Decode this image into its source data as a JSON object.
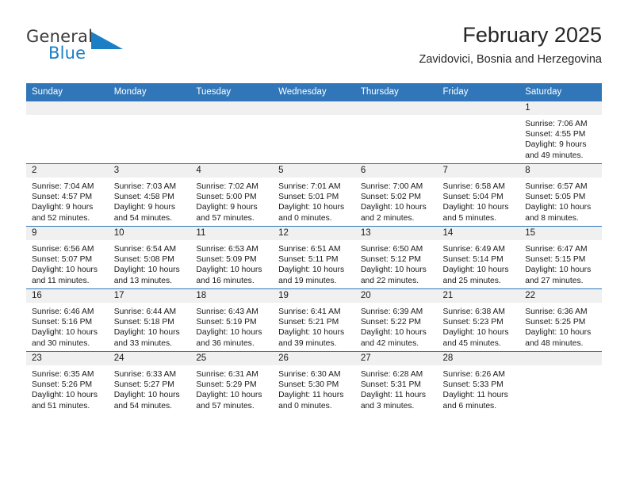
{
  "brand": {
    "name_general": "General",
    "name_blue": "Blue",
    "logo_icon": "blue-triangle-logo"
  },
  "header": {
    "title": "February 2025",
    "subtitle": "Zavidovici, Bosnia and Herzegovina"
  },
  "colors": {
    "header_blue": "#3076b8",
    "brand_blue": "#1c7ec4",
    "daynum_band": "#f0f0f0",
    "text": "#1a1a1a"
  },
  "weekdays": [
    "Sunday",
    "Monday",
    "Tuesday",
    "Wednesday",
    "Thursday",
    "Friday",
    "Saturday"
  ],
  "weeks": [
    [
      {
        "day": "",
        "empty": true
      },
      {
        "day": "",
        "empty": true
      },
      {
        "day": "",
        "empty": true
      },
      {
        "day": "",
        "empty": true
      },
      {
        "day": "",
        "empty": true
      },
      {
        "day": "",
        "empty": true
      },
      {
        "day": "1",
        "sunrise": "Sunrise: 7:06 AM",
        "sunset": "Sunset: 4:55 PM",
        "daylight1": "Daylight: 9 hours",
        "daylight2": "and 49 minutes."
      }
    ],
    [
      {
        "day": "2",
        "sunrise": "Sunrise: 7:04 AM",
        "sunset": "Sunset: 4:57 PM",
        "daylight1": "Daylight: 9 hours",
        "daylight2": "and 52 minutes."
      },
      {
        "day": "3",
        "sunrise": "Sunrise: 7:03 AM",
        "sunset": "Sunset: 4:58 PM",
        "daylight1": "Daylight: 9 hours",
        "daylight2": "and 54 minutes."
      },
      {
        "day": "4",
        "sunrise": "Sunrise: 7:02 AM",
        "sunset": "Sunset: 5:00 PM",
        "daylight1": "Daylight: 9 hours",
        "daylight2": "and 57 minutes."
      },
      {
        "day": "5",
        "sunrise": "Sunrise: 7:01 AM",
        "sunset": "Sunset: 5:01 PM",
        "daylight1": "Daylight: 10 hours",
        "daylight2": "and 0 minutes."
      },
      {
        "day": "6",
        "sunrise": "Sunrise: 7:00 AM",
        "sunset": "Sunset: 5:02 PM",
        "daylight1": "Daylight: 10 hours",
        "daylight2": "and 2 minutes."
      },
      {
        "day": "7",
        "sunrise": "Sunrise: 6:58 AM",
        "sunset": "Sunset: 5:04 PM",
        "daylight1": "Daylight: 10 hours",
        "daylight2": "and 5 minutes."
      },
      {
        "day": "8",
        "sunrise": "Sunrise: 6:57 AM",
        "sunset": "Sunset: 5:05 PM",
        "daylight1": "Daylight: 10 hours",
        "daylight2": "and 8 minutes."
      }
    ],
    [
      {
        "day": "9",
        "sunrise": "Sunrise: 6:56 AM",
        "sunset": "Sunset: 5:07 PM",
        "daylight1": "Daylight: 10 hours",
        "daylight2": "and 11 minutes."
      },
      {
        "day": "10",
        "sunrise": "Sunrise: 6:54 AM",
        "sunset": "Sunset: 5:08 PM",
        "daylight1": "Daylight: 10 hours",
        "daylight2": "and 13 minutes."
      },
      {
        "day": "11",
        "sunrise": "Sunrise: 6:53 AM",
        "sunset": "Sunset: 5:09 PM",
        "daylight1": "Daylight: 10 hours",
        "daylight2": "and 16 minutes."
      },
      {
        "day": "12",
        "sunrise": "Sunrise: 6:51 AM",
        "sunset": "Sunset: 5:11 PM",
        "daylight1": "Daylight: 10 hours",
        "daylight2": "and 19 minutes."
      },
      {
        "day": "13",
        "sunrise": "Sunrise: 6:50 AM",
        "sunset": "Sunset: 5:12 PM",
        "daylight1": "Daylight: 10 hours",
        "daylight2": "and 22 minutes."
      },
      {
        "day": "14",
        "sunrise": "Sunrise: 6:49 AM",
        "sunset": "Sunset: 5:14 PM",
        "daylight1": "Daylight: 10 hours",
        "daylight2": "and 25 minutes."
      },
      {
        "day": "15",
        "sunrise": "Sunrise: 6:47 AM",
        "sunset": "Sunset: 5:15 PM",
        "daylight1": "Daylight: 10 hours",
        "daylight2": "and 27 minutes."
      }
    ],
    [
      {
        "day": "16",
        "sunrise": "Sunrise: 6:46 AM",
        "sunset": "Sunset: 5:16 PM",
        "daylight1": "Daylight: 10 hours",
        "daylight2": "and 30 minutes."
      },
      {
        "day": "17",
        "sunrise": "Sunrise: 6:44 AM",
        "sunset": "Sunset: 5:18 PM",
        "daylight1": "Daylight: 10 hours",
        "daylight2": "and 33 minutes."
      },
      {
        "day": "18",
        "sunrise": "Sunrise: 6:43 AM",
        "sunset": "Sunset: 5:19 PM",
        "daylight1": "Daylight: 10 hours",
        "daylight2": "and 36 minutes."
      },
      {
        "day": "19",
        "sunrise": "Sunrise: 6:41 AM",
        "sunset": "Sunset: 5:21 PM",
        "daylight1": "Daylight: 10 hours",
        "daylight2": "and 39 minutes."
      },
      {
        "day": "20",
        "sunrise": "Sunrise: 6:39 AM",
        "sunset": "Sunset: 5:22 PM",
        "daylight1": "Daylight: 10 hours",
        "daylight2": "and 42 minutes."
      },
      {
        "day": "21",
        "sunrise": "Sunrise: 6:38 AM",
        "sunset": "Sunset: 5:23 PM",
        "daylight1": "Daylight: 10 hours",
        "daylight2": "and 45 minutes."
      },
      {
        "day": "22",
        "sunrise": "Sunrise: 6:36 AM",
        "sunset": "Sunset: 5:25 PM",
        "daylight1": "Daylight: 10 hours",
        "daylight2": "and 48 minutes."
      }
    ],
    [
      {
        "day": "23",
        "sunrise": "Sunrise: 6:35 AM",
        "sunset": "Sunset: 5:26 PM",
        "daylight1": "Daylight: 10 hours",
        "daylight2": "and 51 minutes."
      },
      {
        "day": "24",
        "sunrise": "Sunrise: 6:33 AM",
        "sunset": "Sunset: 5:27 PM",
        "daylight1": "Daylight: 10 hours",
        "daylight2": "and 54 minutes."
      },
      {
        "day": "25",
        "sunrise": "Sunrise: 6:31 AM",
        "sunset": "Sunset: 5:29 PM",
        "daylight1": "Daylight: 10 hours",
        "daylight2": "and 57 minutes."
      },
      {
        "day": "26",
        "sunrise": "Sunrise: 6:30 AM",
        "sunset": "Sunset: 5:30 PM",
        "daylight1": "Daylight: 11 hours",
        "daylight2": "and 0 minutes."
      },
      {
        "day": "27",
        "sunrise": "Sunrise: 6:28 AM",
        "sunset": "Sunset: 5:31 PM",
        "daylight1": "Daylight: 11 hours",
        "daylight2": "and 3 minutes."
      },
      {
        "day": "28",
        "sunrise": "Sunrise: 6:26 AM",
        "sunset": "Sunset: 5:33 PM",
        "daylight1": "Daylight: 11 hours",
        "daylight2": "and 6 minutes."
      },
      {
        "day": "",
        "empty": true
      }
    ]
  ]
}
